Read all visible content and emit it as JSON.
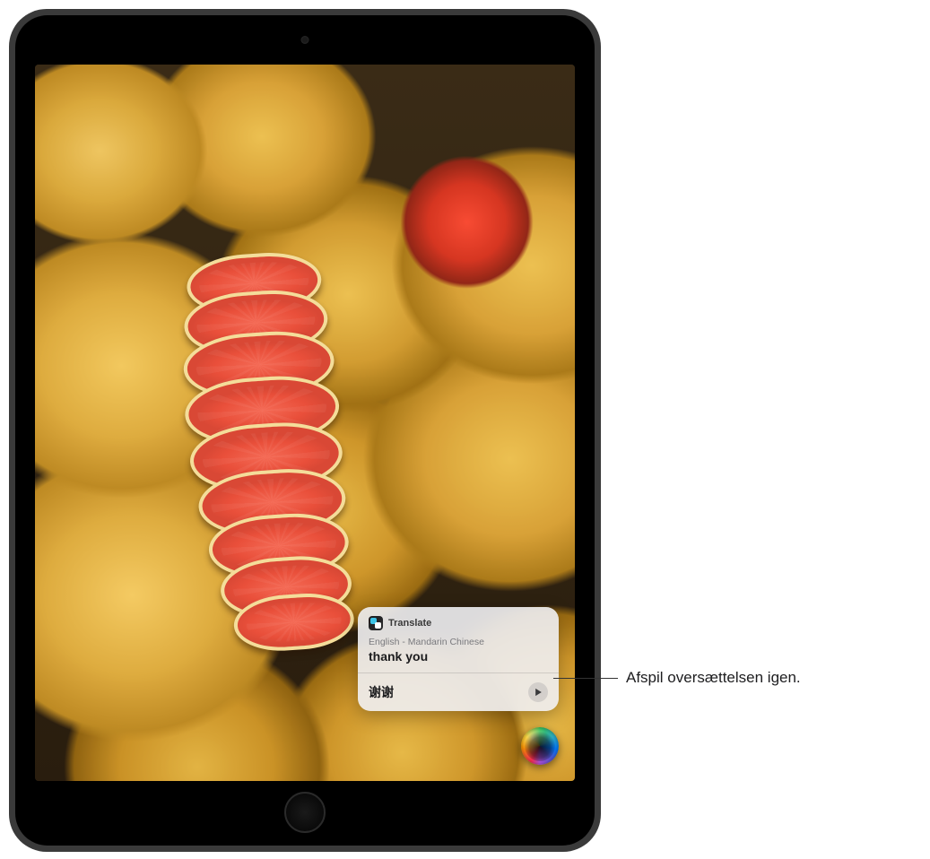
{
  "translate_card": {
    "app_name": "Translate",
    "language_pair": "English - Mandarin Chinese",
    "source_phrase": "thank you",
    "translated_phrase": "谢谢"
  },
  "callout": {
    "label": "Afspil oversættelsen igen."
  },
  "icons": {
    "translate_app": "translate-app-icon",
    "play": "play-icon",
    "siri": "siri-orb"
  }
}
